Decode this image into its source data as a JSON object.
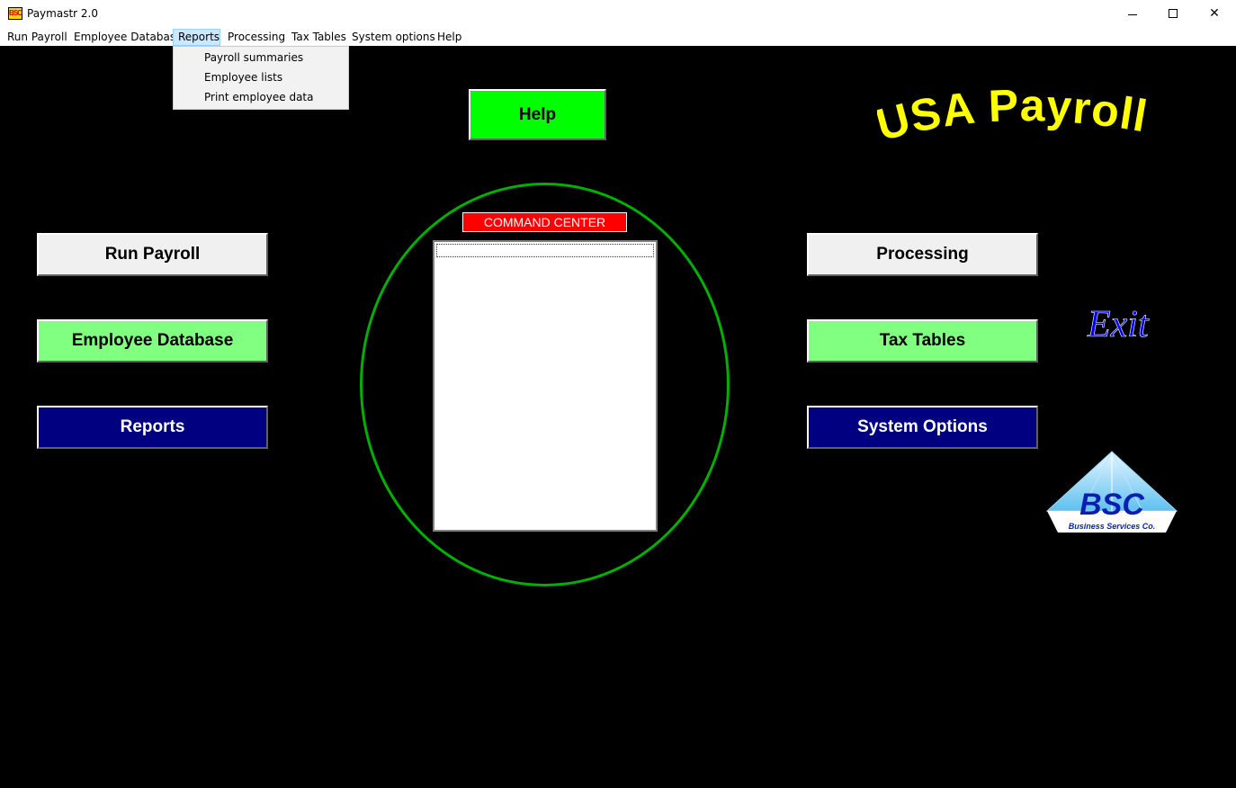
{
  "window": {
    "title": "Paymastr 2.0",
    "icon_text": "BSC",
    "minimize_icon": "minimize-icon",
    "maximize_icon": "maximize-icon",
    "close_icon": "close-icon",
    "close_glyph": "✕"
  },
  "menubar": {
    "items": [
      "Run Payroll",
      "Employee Database",
      "Reports",
      "Processing",
      "Tax Tables",
      "System options",
      "Help"
    ],
    "active": "Reports"
  },
  "reports_menu": {
    "items": [
      "Payroll summaries",
      "Employee lists",
      "Print employee data"
    ]
  },
  "main": {
    "help_label": "Help",
    "brand_title": "USA Payroll",
    "exit_label": "Exit",
    "left_buttons": [
      "Run Payroll",
      "Employee Database",
      "Reports"
    ],
    "right_buttons": [
      "Processing",
      "Tax Tables",
      "System Options"
    ],
    "command_center_label": "COMMAND CENTER",
    "logo": {
      "letters": "BSC",
      "subtitle": "Business Services Co."
    }
  },
  "colors": {
    "background": "#000000",
    "help_green": "#00ff00",
    "light_green": "#80ff80",
    "navy": "#000080",
    "brand_yellow": "#ffff00",
    "exit_blue": "#0000ff",
    "command_red": "#ff0000",
    "circle_green": "#00b000"
  }
}
